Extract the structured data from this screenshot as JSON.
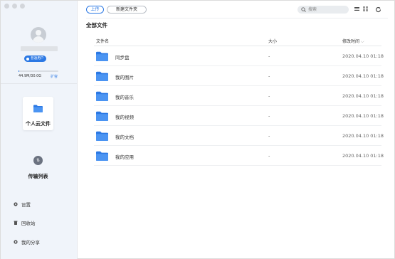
{
  "sidebar": {
    "badge_label": "普通用户",
    "quota_text": "44.9M/30.0G",
    "quota_fraction": 0.0015,
    "expand_label": "扩容",
    "personal_cloud_label": "个人云文件",
    "transfer_label": "传输列表",
    "links": {
      "settings": "设置",
      "recycle": "回收站",
      "shares": "我的分享"
    }
  },
  "toolbar": {
    "upload_label": "上传",
    "new_folder_label": "新建文件夹",
    "search_placeholder": "搜索"
  },
  "main": {
    "breadcrumb": "全部文件",
    "columns": {
      "name": "文件名",
      "size": "大小",
      "modified": "修改时间"
    },
    "files": [
      {
        "name": "同步盘",
        "size": "-",
        "modified": "2020.04.10 01:18"
      },
      {
        "name": "我的图片",
        "size": "-",
        "modified": "2020.04.10 01:18"
      },
      {
        "name": "我的音乐",
        "size": "-",
        "modified": "2020.04.10 01:18"
      },
      {
        "name": "我的视频",
        "size": "-",
        "modified": "2020.04.10 01:18"
      },
      {
        "name": "我的文档",
        "size": "-",
        "modified": "2020.04.10 01:18"
      },
      {
        "name": "我的应用",
        "size": "-",
        "modified": "2020.04.10 01:18"
      }
    ]
  },
  "colors": {
    "accent": "#2b78e4",
    "folder": "#3d8ef0",
    "sidebar_bg": "#f0f4fa"
  },
  "icons": {
    "folder": "folder-icon",
    "search": "search-icon",
    "list_view": "list-view-icon",
    "grid_view": "grid-view-icon",
    "refresh": "refresh-icon",
    "settings": "gear-icon",
    "recycle": "trash-icon",
    "share": "share-icon",
    "transfer": "transfer-icon"
  }
}
